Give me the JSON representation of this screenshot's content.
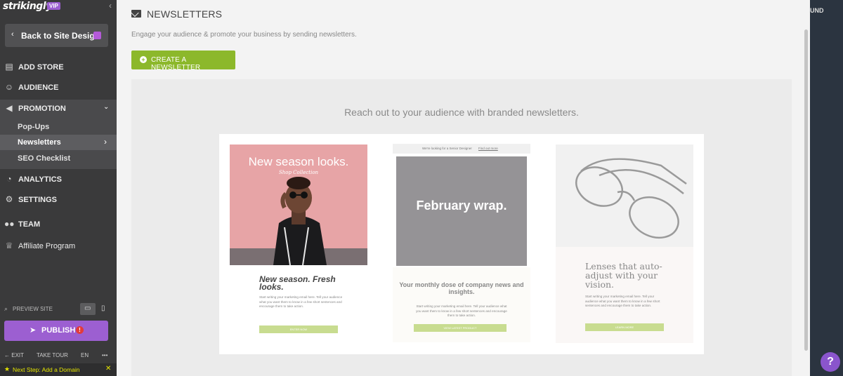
{
  "sidebar": {
    "logo": "strikingly",
    "vip": "VIP",
    "back_label": "Back to Site Design",
    "nav": {
      "add_store": "ADD STORE",
      "audience": "AUDIENCE",
      "promotion": "PROMOTION",
      "analytics": "ANALYTICS",
      "settings": "SETTINGS",
      "team": "TEAM",
      "affiliate": "Affiliate Program"
    },
    "promotion_items": [
      "Pop-Ups",
      "Newsletters",
      "SEO Checklist"
    ],
    "preview_site": "PREVIEW SITE",
    "publish": "PUBLISH",
    "publish_badge": "!",
    "footer": {
      "exit": "EXIT",
      "take_tour": "TAKE TOUR",
      "lang": "EN",
      "more": "•••"
    },
    "next_step": "Next Step: Add a Domain"
  },
  "main": {
    "title": "NEWSLETTERS",
    "subtitle": "Engage your audience & promote your business by sending newsletters.",
    "create_button": "CREATE A NEWSLETTER",
    "panel_title": "Reach out to your audience with branded newsletters.",
    "card1": {
      "title": "New season looks.",
      "subtitle": "Shop Collection",
      "heading": "New season. Fresh looks.",
      "body": "Start writing your marketing email here. Tell your audience what you want them to know in a few short sentences and encourage them to take action.",
      "button": "ENTER NOW"
    },
    "card2": {
      "banner": "We're looking for a Senior Designer",
      "banner_link": "Find out more",
      "title": "February wrap.",
      "heading": "Your monthly dose of company news and insights.",
      "body": "Start writing your marketing email here. Tell your audience what you want them to know in a few short sentences and encourage them to take action.",
      "button": "VIEW LATEST PRODUCT"
    },
    "card3": {
      "heading": "Lenses that auto-adjust with your vision.",
      "body": "Start writing your marketing email here. Tell your audience what you want them to know in a few short sentences and encourage them to take action.",
      "button": "LEARN MORE"
    }
  },
  "right_strip": {
    "text": "UND"
  },
  "help": "?",
  "colors": {
    "accent": "#9c5fd1",
    "create_green": "#8cb82b",
    "sidebar": "#3a3a3b"
  }
}
